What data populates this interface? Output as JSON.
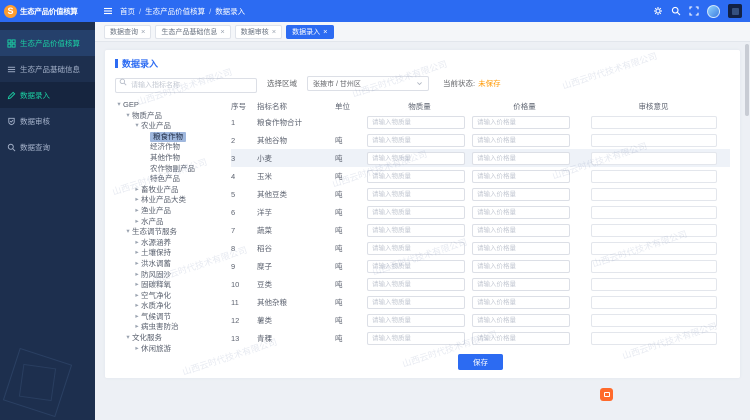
{
  "app": {
    "logo_glyph": "S"
  },
  "sidebar": {
    "logo_text": "生态产品价值核算",
    "items": [
      {
        "label": "生态产品价值核算"
      },
      {
        "label": "生态产品基础信息"
      },
      {
        "label": "数据录入"
      },
      {
        "label": "数据审核"
      },
      {
        "label": "数据查询"
      }
    ]
  },
  "header": {
    "breadcrumb": {
      "home": "首页",
      "section": "生态产品价值核算",
      "page": "数据录入",
      "sep": "/"
    }
  },
  "tabbar": {
    "close": "×",
    "tabs": [
      {
        "label": "数据查询"
      },
      {
        "label": "生态产品基础信息"
      },
      {
        "label": "数据审核"
      },
      {
        "label": "数据录入"
      }
    ]
  },
  "page": {
    "title": "数据录入",
    "search_placeholder": "请输入指标名称",
    "region_label": "选择区域",
    "region_value": "张掖市 / 甘州区",
    "status_label": "当前状态:",
    "status_value": "未保存",
    "save_label": "保存"
  },
  "tree": {
    "items": [
      {
        "label": "GEP",
        "caret": "▾"
      },
      {
        "label": "物质产品",
        "caret": "▾"
      },
      {
        "label": "农业产品",
        "caret": "▾"
      },
      {
        "label": "粮食作物",
        "caret": ""
      },
      {
        "label": "经济作物",
        "caret": ""
      },
      {
        "label": "其他作物",
        "caret": ""
      },
      {
        "label": "农作物副产品",
        "caret": ""
      },
      {
        "label": "特色产品",
        "caret": ""
      },
      {
        "label": "畜牧业产品",
        "caret": "▸"
      },
      {
        "label": "林业产品大类",
        "caret": "▸"
      },
      {
        "label": "渔业产品",
        "caret": "▸"
      },
      {
        "label": "水产品",
        "caret": "▸"
      },
      {
        "label": "生态调节服务",
        "caret": "▾"
      },
      {
        "label": "水源涵养",
        "caret": "▸"
      },
      {
        "label": "土壤保持",
        "caret": "▸"
      },
      {
        "label": "洪水调蓄",
        "caret": "▸"
      },
      {
        "label": "防风固沙",
        "caret": "▸"
      },
      {
        "label": "固碳释氧",
        "caret": "▸"
      },
      {
        "label": "空气净化",
        "caret": "▸"
      },
      {
        "label": "水质净化",
        "caret": "▸"
      },
      {
        "label": "气候调节",
        "caret": "▸"
      },
      {
        "label": "病虫害防治",
        "caret": "▸"
      },
      {
        "label": "文化服务",
        "caret": "▾"
      },
      {
        "label": "休闲旅游",
        "caret": "▸"
      }
    ]
  },
  "table": {
    "headers": [
      "序号",
      "指标名称",
      "单位",
      "物质量",
      "价格量",
      "审核意见"
    ],
    "qty_placeholder": "请输入物质量",
    "price_placeholder": "请输入价格量",
    "rows": [
      {
        "no": "1",
        "name": "粮食作物合计",
        "unit": ""
      },
      {
        "no": "2",
        "name": "其他谷物",
        "unit": "吨"
      },
      {
        "no": "3",
        "name": "小麦",
        "unit": "吨"
      },
      {
        "no": "4",
        "name": "玉米",
        "unit": "吨"
      },
      {
        "no": "5",
        "name": "其他豆类",
        "unit": "吨"
      },
      {
        "no": "6",
        "name": "洋芋",
        "unit": "吨"
      },
      {
        "no": "7",
        "name": "蔬菜",
        "unit": "吨"
      },
      {
        "no": "8",
        "name": "稻谷",
        "unit": "吨"
      },
      {
        "no": "9",
        "name": "糜子",
        "unit": "吨"
      },
      {
        "no": "10",
        "name": "豆类",
        "unit": "吨"
      },
      {
        "no": "11",
        "name": "其他杂粮",
        "unit": "吨"
      },
      {
        "no": "12",
        "name": "薯类",
        "unit": "吨"
      },
      {
        "no": "13",
        "name": "青稞",
        "unit": "吨"
      }
    ]
  },
  "watermark": {
    "text": "山西云时代技术有限公司"
  }
}
